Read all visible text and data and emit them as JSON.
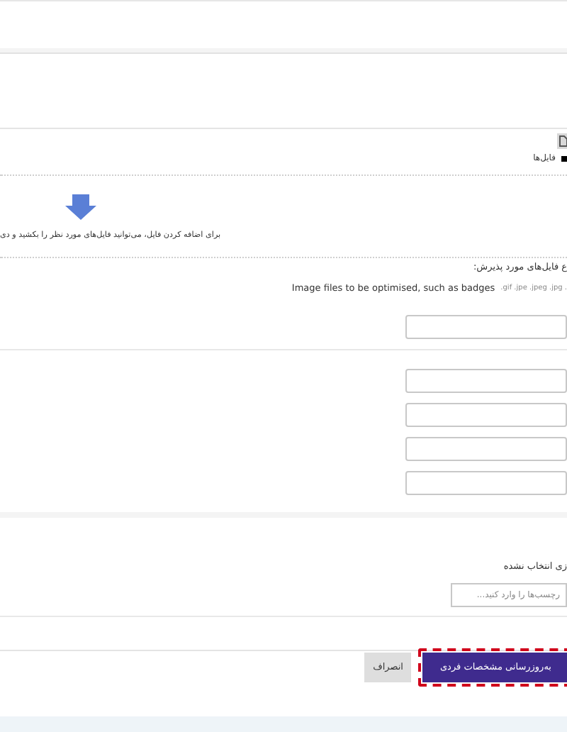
{
  "files": {
    "link": "فایل‌ها"
  },
  "dropzone": {
    "hint": "برای اضافه کردن فایل، می‌توانید فایل‌های مورد نظر را بکشید و دی"
  },
  "accepted": {
    "label": "ع فایل‌های مورد پذیرش:",
    "description": "Image files to be optimised, such as badges",
    "extensions": ".gif .jpe .jpeg .jpg ."
  },
  "fields": [
    {
      "kind": "single"
    },
    {
      "kind": "group"
    },
    {
      "kind": "group"
    },
    {
      "kind": "group"
    },
    {
      "kind": "group"
    }
  ],
  "tags": {
    "status": "زی انتخاب نشده",
    "placeholder": "رچسب‌ها را وارد کنید..."
  },
  "buttons": [
    {
      "label": "به‌روزرسانی مشخصات فردی",
      "kind": "primary",
      "highlighted": true
    },
    {
      "label": "انصراف",
      "kind": "secondary",
      "highlighted": false
    }
  ]
}
